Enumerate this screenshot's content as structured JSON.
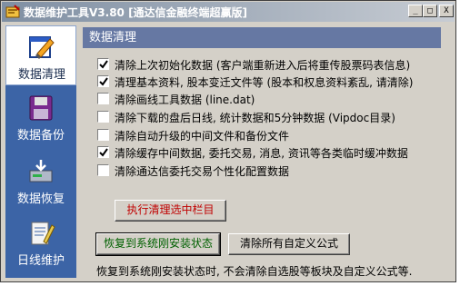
{
  "window": {
    "title": "数据维护工具V3.80 [通达信金融终端超赢版]",
    "controls": {
      "minimize": "_",
      "maximize": "□",
      "close": "X"
    }
  },
  "sidebar": {
    "items": [
      {
        "label": "数据清理",
        "icon": "broom-edit-icon",
        "active": true
      },
      {
        "label": "数据备份",
        "icon": "floppy-disk-icon",
        "active": false
      },
      {
        "label": "数据恢复",
        "icon": "disk-restore-icon",
        "active": false
      },
      {
        "label": "日线维护",
        "icon": "notepad-pencil-icon",
        "active": false
      }
    ]
  },
  "panel": {
    "header": "数据清理",
    "options": [
      {
        "label": "清除上次初始化数据 (客户端重新进入后将重传股票码表信息)",
        "checked": true
      },
      {
        "label": "清理基本资料, 股本变迁文件等 (股本和权息资料紊乱, 请清除)",
        "checked": true
      },
      {
        "label": "清除画线工具数据 (line.dat)",
        "checked": false
      },
      {
        "label": "清除下载的盘后日线, 统计数据和5分钟数据 (Vipdoc目录)",
        "checked": false
      },
      {
        "label": "清除自动升级的中间文件和备份文件",
        "checked": false
      },
      {
        "label": "清除缓存中间数据, 委托交易, 消息, 资讯等各类临时缓冲数据",
        "checked": true
      },
      {
        "label": "清除通达信委托交易个性化配置数据",
        "checked": false
      }
    ],
    "execute_button": "执行清理选中栏目",
    "restore_button": "恢复到系统刚安装状态",
    "clear_formula_button": "清除所有自定义公式",
    "note": "恢复到系统刚安装状态时, 不会清除自选股等板块及自定义公式等."
  }
}
